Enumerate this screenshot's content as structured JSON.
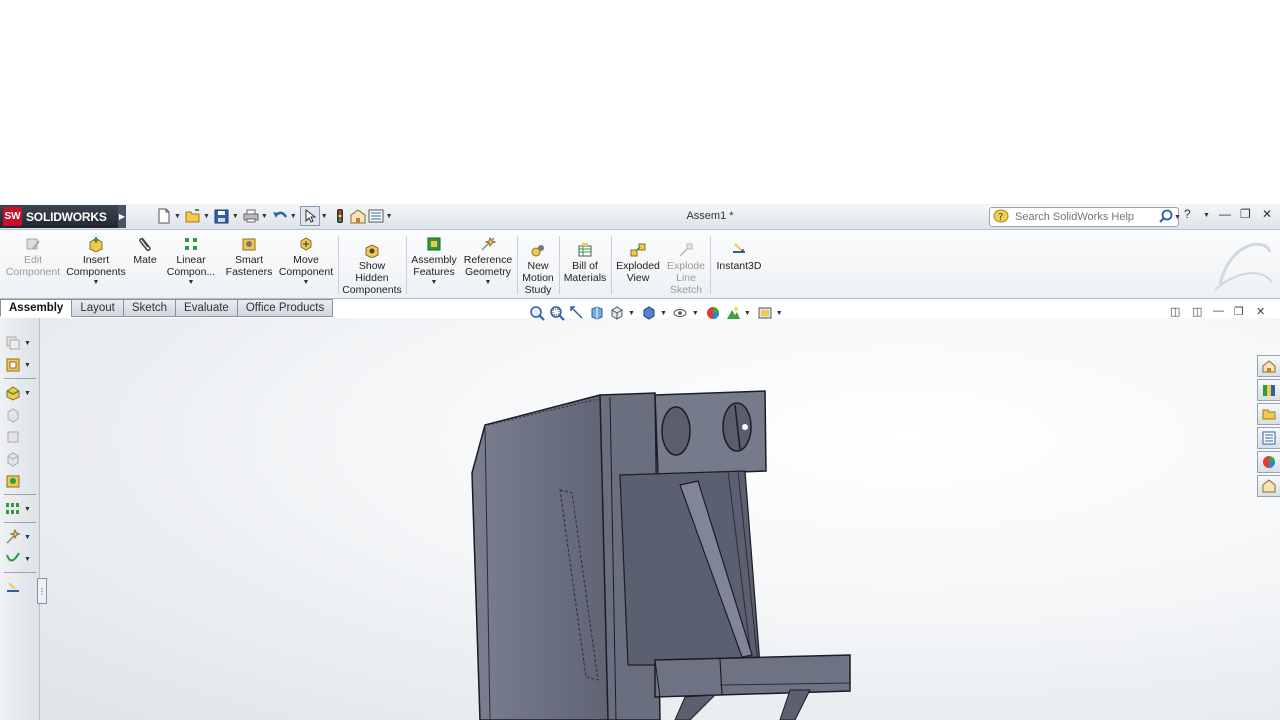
{
  "app": {
    "logo_mark": "SW",
    "logo_text": "SOLIDWORKS",
    "document_title": "Assem1 *"
  },
  "search": {
    "placeholder": "Search SolidWorks Help"
  },
  "command_manager": {
    "tools": [
      {
        "id": "edit-component",
        "label": "Edit Component",
        "enabled": false
      },
      {
        "id": "insert-components",
        "label": "Insert Components",
        "enabled": true
      },
      {
        "id": "mate",
        "label": "Mate",
        "enabled": true
      },
      {
        "id": "linear-component-pattern",
        "label": "Linear Compon...",
        "enabled": true
      },
      {
        "id": "smart-fasteners",
        "label": "Smart Fasteners",
        "enabled": true
      },
      {
        "id": "move-component",
        "label": "Move Component",
        "enabled": true
      },
      {
        "id": "show-hidden-components",
        "label": "Show Hidden Components",
        "enabled": true
      },
      {
        "id": "assembly-features",
        "label": "Assembly Features",
        "enabled": true
      },
      {
        "id": "reference-geometry",
        "label": "Reference Geometry",
        "enabled": true
      },
      {
        "id": "new-motion-study",
        "label": "New Motion Study",
        "enabled": true
      },
      {
        "id": "bill-of-materials",
        "label": "Bill of Materials",
        "enabled": true
      },
      {
        "id": "exploded-view",
        "label": "Exploded View",
        "enabled": true
      },
      {
        "id": "explode-line-sketch",
        "label": "Explode Line Sketch",
        "enabled": false
      },
      {
        "id": "instant3d",
        "label": "Instant3D",
        "enabled": true
      }
    ]
  },
  "tabs": [
    {
      "label": "Assembly",
      "active": true
    },
    {
      "label": "Layout",
      "active": false
    },
    {
      "label": "Sketch",
      "active": false
    },
    {
      "label": "Evaluate",
      "active": false
    },
    {
      "label": "Office Products",
      "active": false
    }
  ],
  "colors": {
    "brand_red": "#c8102e",
    "model_fill": "#6e7384",
    "model_edge": "#1c1d24",
    "viewport_light": "#ffffff",
    "viewport_dark": "#dfe3e8"
  }
}
